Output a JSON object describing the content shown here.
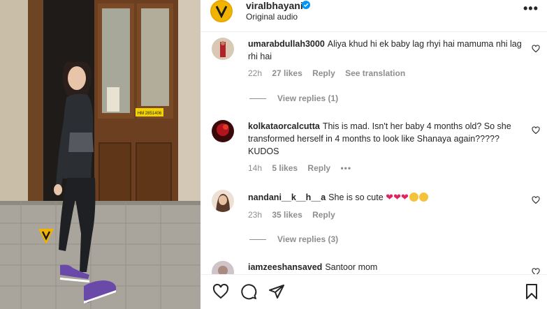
{
  "post": {
    "username": "viralbhayani",
    "subtitle": "Original audio",
    "more_label": "•••",
    "watermark_text": "VIRAL BHAYANI",
    "door_sign": "HM 2851406"
  },
  "comments": [
    {
      "user": "umarabdullah3000",
      "text": "Aliya khud hi ek baby lag rhyi hai mamuma nhi lag rhi hai",
      "time": "22h",
      "likes": "27 likes",
      "reply": "Reply",
      "translate": "See translation",
      "view_replies": "View replies (1)"
    },
    {
      "user": "kolkataorcalcutta",
      "text": "This is mad. Isn't her baby 4 months old? So she transformed herself in 4 months to look like Shanaya again????? KUDOS",
      "time": "14h",
      "likes": "5 likes",
      "reply": "Reply",
      "more": "•••"
    },
    {
      "user": "nandani__k__h__a",
      "text": "She is so cute",
      "time": "23h",
      "likes": "35 likes",
      "reply": "Reply",
      "view_replies": "View replies (3)"
    },
    {
      "user": "iamzeeshansaved",
      "text": "Santoor mom"
    }
  ],
  "colors": {
    "verified": "#0095f6",
    "heart_red": "#e0245e",
    "meta_gray": "#8e8e8e",
    "brand_yellow": "#f0b400"
  },
  "icons": {
    "like": "heart-outline-icon",
    "comment": "speech-bubble-icon",
    "share": "paper-plane-icon",
    "save": "bookmark-icon"
  }
}
